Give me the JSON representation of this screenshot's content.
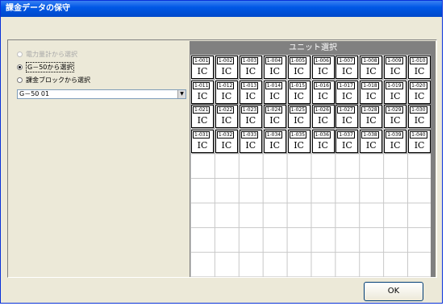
{
  "window": {
    "title": "課金データの保守"
  },
  "options": {
    "items": [
      {
        "label": "電力量計から選択",
        "enabled": false,
        "checked": false
      },
      {
        "label": "G－50から選択",
        "enabled": true,
        "checked": true
      },
      {
        "label": "課金ブロックから選択",
        "enabled": true,
        "checked": false
      }
    ],
    "combo_value": "G－50 01"
  },
  "units": {
    "header": "ユニット選択",
    "cells": [
      {
        "id": "1-001",
        "label": "IC"
      },
      {
        "id": "1-002",
        "label": "IC"
      },
      {
        "id": "1-003",
        "label": "IC"
      },
      {
        "id": "1-004",
        "label": "IC"
      },
      {
        "id": "1-005",
        "label": "IC"
      },
      {
        "id": "1-006",
        "label": "IC"
      },
      {
        "id": "1-007",
        "label": "IC"
      },
      {
        "id": "1-008",
        "label": "IC"
      },
      {
        "id": "1-009",
        "label": "IC"
      },
      {
        "id": "1-010",
        "label": "IC"
      },
      {
        "id": "1-011",
        "label": "IC"
      },
      {
        "id": "1-012",
        "label": "IC"
      },
      {
        "id": "1-013",
        "label": "IC"
      },
      {
        "id": "1-014",
        "label": "IC"
      },
      {
        "id": "1-015",
        "label": "IC"
      },
      {
        "id": "1-016",
        "label": "IC"
      },
      {
        "id": "1-017",
        "label": "IC"
      },
      {
        "id": "1-018",
        "label": "IC"
      },
      {
        "id": "1-019",
        "label": "IC"
      },
      {
        "id": "1-020",
        "label": "IC"
      },
      {
        "id": "1-021",
        "label": "IC"
      },
      {
        "id": "1-022",
        "label": "IC"
      },
      {
        "id": "1-023",
        "label": "IC"
      },
      {
        "id": "1-024",
        "label": "IC"
      },
      {
        "id": "1-025",
        "label": "IC"
      },
      {
        "id": "1-026",
        "label": "IC"
      },
      {
        "id": "1-027",
        "label": "IC"
      },
      {
        "id": "1-028",
        "label": "IC"
      },
      {
        "id": "1-029",
        "label": "IC"
      },
      {
        "id": "1-030",
        "label": "IC"
      },
      {
        "id": "1-031",
        "label": "IC"
      },
      {
        "id": "1-032",
        "label": "IC"
      },
      {
        "id": "1-033",
        "label": "IC"
      },
      {
        "id": "1-034",
        "label": "IC"
      },
      {
        "id": "1-035",
        "label": "IC"
      },
      {
        "id": "1-036",
        "label": "IC"
      },
      {
        "id": "1-037",
        "label": "IC"
      },
      {
        "id": "1-038",
        "label": "IC"
      },
      {
        "id": "1-039",
        "label": "IC"
      },
      {
        "id": "1-040",
        "label": "IC"
      }
    ]
  },
  "buttons": {
    "ok": "OK"
  }
}
